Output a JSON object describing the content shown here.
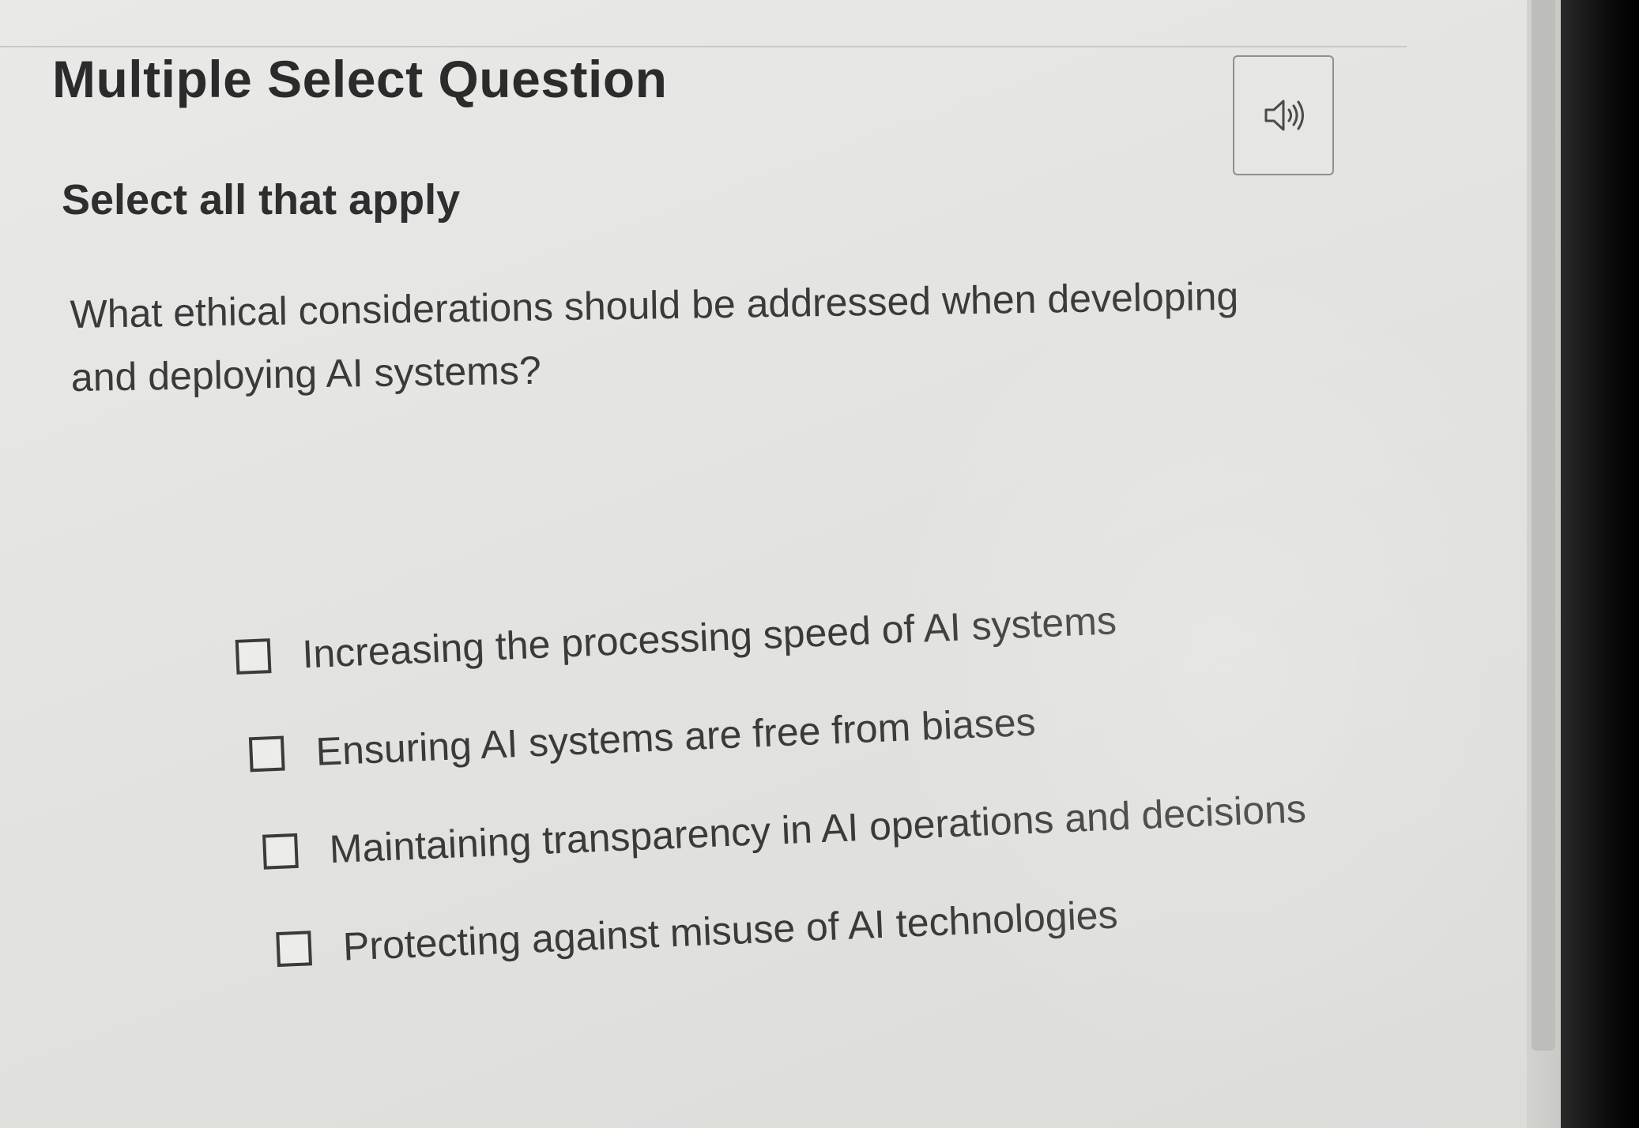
{
  "question": {
    "type_title": "Multiple Select Question",
    "instruction": "Select all that apply",
    "prompt": "What ethical considerations should be addressed when developing and deploying AI systems?",
    "options": [
      {
        "label": "Increasing the processing speed of AI systems",
        "checked": false
      },
      {
        "label": "Ensuring AI systems are free from biases",
        "checked": false
      },
      {
        "label": "Maintaining transparency in AI operations and decisions",
        "checked": false
      },
      {
        "label": "Protecting against misuse of AI technologies",
        "checked": false
      }
    ]
  },
  "audio_button": {
    "icon": "speaker-icon"
  },
  "colors": {
    "background": "#e6e6e3",
    "text": "#3a3a3a",
    "title": "#2b2b2b",
    "border": "#8f8f8c"
  }
}
